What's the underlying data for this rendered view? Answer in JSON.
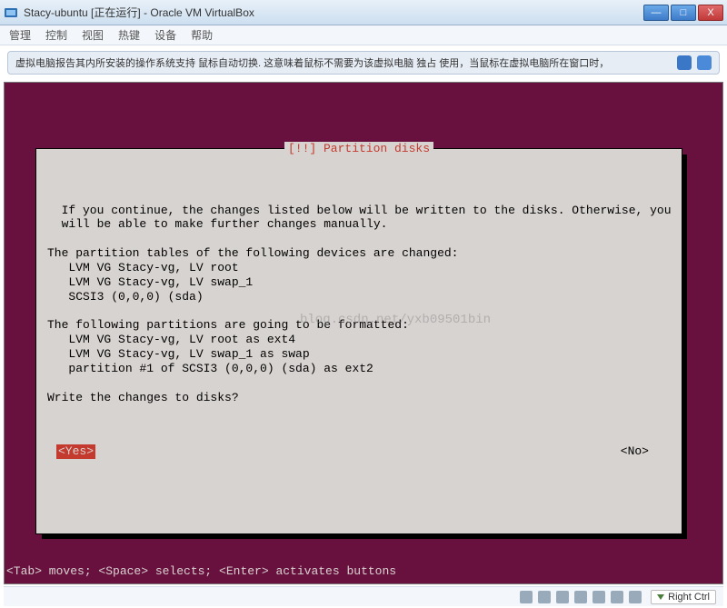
{
  "window": {
    "title": "Stacy-ubuntu [正在运行] - Oracle VM VirtualBox",
    "buttons": {
      "min": "—",
      "max": "□",
      "close": "X"
    }
  },
  "menu": [
    "管理",
    "控制",
    "视图",
    "热键",
    "设备",
    "帮助"
  ],
  "infostrip": {
    "text": "虚拟电脑报告其内所安装的操作系统支持 鼠标自动切换. 这意味着鼠标不需要为该虚拟电脑 独占 使用，当鼠标在虚拟电脑所在窗口时，"
  },
  "dialog": {
    "title": "[!!] Partition disks",
    "body": "  If you continue, the changes listed below will be written to the disks. Otherwise, you\n  will be able to make further changes manually.\n\nThe partition tables of the following devices are changed:\n   LVM VG Stacy-vg, LV root\n   LVM VG Stacy-vg, LV swap_1\n   SCSI3 (0,0,0) (sda)\n\nThe following partitions are going to be formatted:\n   LVM VG Stacy-vg, LV root as ext4\n   LVM VG Stacy-vg, LV swap_1 as swap\n   partition #1 of SCSI3 (0,0,0) (sda) as ext2\n\nWrite the changes to disks?",
    "yes": "<Yes>",
    "no": "<No>"
  },
  "watermark": "blog.csdn.net/yxb09501bin",
  "helpline": "<Tab> moves; <Space> selects; <Enter> activates buttons",
  "statusbar": {
    "hostkey": "Right Ctrl"
  }
}
